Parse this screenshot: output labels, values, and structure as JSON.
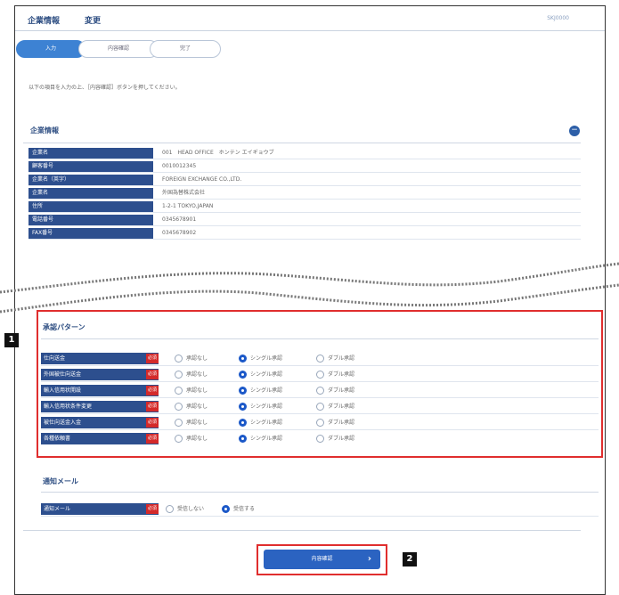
{
  "header": {
    "title": "企業情報",
    "subtitle": "変更",
    "screen_id": "SKJ0000"
  },
  "steps": [
    {
      "label": "入力",
      "active": true
    },
    {
      "label": "内容確認",
      "active": false
    },
    {
      "label": "完了",
      "active": false
    }
  ],
  "intro": "以下の項目を入力の上、［内容確認］ボタンを押してください。",
  "corp_section": {
    "title": "企業情報",
    "collapse_icon": "minus-circle-icon",
    "rows": [
      {
        "label": "企業名",
        "value": "001　HEAD OFFICE　ホンテン エイギョウブ"
      },
      {
        "label": "顧客番号",
        "value": "0010012345"
      },
      {
        "label": "企業名（英字）",
        "value": "FOREIGN EXCHANGE CO.,LTD."
      },
      {
        "label": "企業名",
        "value": "外国為替株式会社"
      },
      {
        "label": "住所",
        "value": "1-2-1 TOKYO,JAPAN"
      },
      {
        "label": "電話番号",
        "value": "0345678901"
      },
      {
        "label": "FAX番号",
        "value": "0345678902"
      }
    ]
  },
  "approval_section": {
    "title": "承認パターン",
    "badge": "1",
    "required_label": "必須",
    "options": [
      "承認なし",
      "シングル承認",
      "ダブル承認"
    ],
    "rows": [
      {
        "label": "仕向送金",
        "selected": 1
      },
      {
        "label": "外国被仕向送金",
        "selected": 1
      },
      {
        "label": "輸入信用状開設",
        "selected": 1
      },
      {
        "label": "輸入信用状条件変更",
        "selected": 1
      },
      {
        "label": "被仕向送金入金",
        "selected": 1
      },
      {
        "label": "各種依頼書",
        "selected": 1
      }
    ]
  },
  "mail_section": {
    "title": "通知メール",
    "row_label": "通知メール",
    "required_label": "必須",
    "options": [
      "受信しない",
      "受信する"
    ],
    "selected": 1
  },
  "confirm_button": {
    "label": "内容確認",
    "badge": "2"
  }
}
